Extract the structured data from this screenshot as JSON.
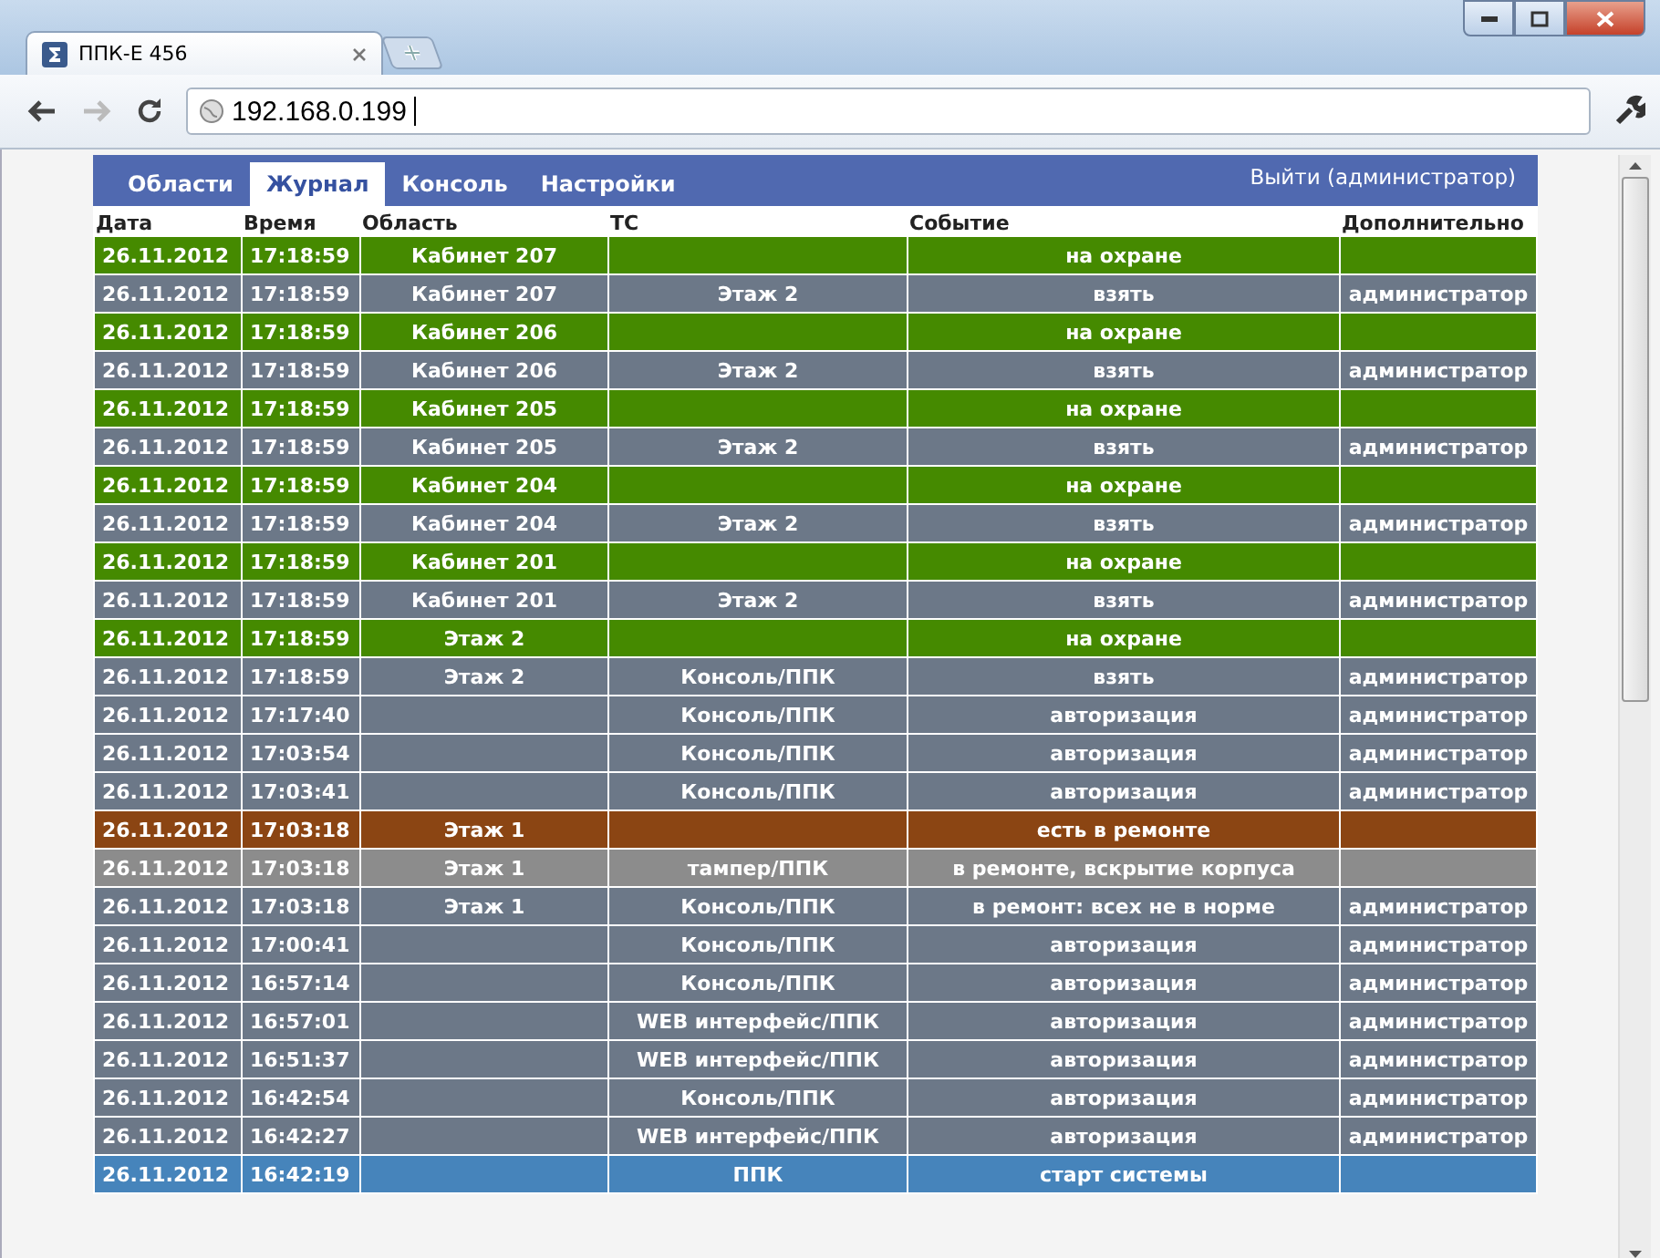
{
  "browser": {
    "tab_title": "ППК-Е 456",
    "address": "192.168.0.199"
  },
  "nav": {
    "tabs": [
      {
        "label": "Области",
        "selected": false
      },
      {
        "label": "Журнал",
        "selected": true
      },
      {
        "label": "Консоль",
        "selected": false
      },
      {
        "label": "Настройки",
        "selected": false
      }
    ],
    "logout": "Выйти (администратор)"
  },
  "table": {
    "columns": [
      "Дата",
      "Время",
      "Область",
      "ТС",
      "Событие",
      "Дополнительно"
    ],
    "rows": [
      {
        "kind": "armed",
        "cells": [
          "26.11.2012",
          "17:18:59",
          "Кабинет 207",
          "",
          "на охране",
          ""
        ]
      },
      {
        "kind": "event",
        "cells": [
          "26.11.2012",
          "17:18:59",
          "Кабинет 207",
          "Этаж 2",
          "взять",
          "администратор"
        ]
      },
      {
        "kind": "armed",
        "cells": [
          "26.11.2012",
          "17:18:59",
          "Кабинет 206",
          "",
          "на охране",
          ""
        ]
      },
      {
        "kind": "event",
        "cells": [
          "26.11.2012",
          "17:18:59",
          "Кабинет 206",
          "Этаж 2",
          "взять",
          "администратор"
        ]
      },
      {
        "kind": "armed",
        "cells": [
          "26.11.2012",
          "17:18:59",
          "Кабинет 205",
          "",
          "на охране",
          ""
        ]
      },
      {
        "kind": "event",
        "cells": [
          "26.11.2012",
          "17:18:59",
          "Кабинет 205",
          "Этаж 2",
          "взять",
          "администратор"
        ]
      },
      {
        "kind": "armed",
        "cells": [
          "26.11.2012",
          "17:18:59",
          "Кабинет 204",
          "",
          "на охране",
          ""
        ]
      },
      {
        "kind": "event",
        "cells": [
          "26.11.2012",
          "17:18:59",
          "Кабинет 204",
          "Этаж 2",
          "взять",
          "администратор"
        ]
      },
      {
        "kind": "armed",
        "cells": [
          "26.11.2012",
          "17:18:59",
          "Кабинет 201",
          "",
          "на охране",
          ""
        ]
      },
      {
        "kind": "event",
        "cells": [
          "26.11.2012",
          "17:18:59",
          "Кабинет 201",
          "Этаж 2",
          "взять",
          "администратор"
        ]
      },
      {
        "kind": "armed",
        "cells": [
          "26.11.2012",
          "17:18:59",
          "Этаж 2",
          "",
          "на охране",
          ""
        ]
      },
      {
        "kind": "event",
        "cells": [
          "26.11.2012",
          "17:18:59",
          "Этаж 2",
          "Консоль/ППК",
          "взять",
          "администратор"
        ]
      },
      {
        "kind": "event",
        "cells": [
          "26.11.2012",
          "17:17:40",
          "",
          "Консоль/ППК",
          "авторизация",
          "администратор"
        ]
      },
      {
        "kind": "event",
        "cells": [
          "26.11.2012",
          "17:03:54",
          "",
          "Консоль/ППК",
          "авторизация",
          "администратор"
        ]
      },
      {
        "kind": "event",
        "cells": [
          "26.11.2012",
          "17:03:41",
          "",
          "Консоль/ППК",
          "авторизация",
          "администратор"
        ]
      },
      {
        "kind": "repair",
        "cells": [
          "26.11.2012",
          "17:03:18",
          "Этаж 1",
          "",
          "есть в ремонте",
          ""
        ]
      },
      {
        "kind": "fault",
        "cells": [
          "26.11.2012",
          "17:03:18",
          "Этаж 1",
          "тампер/ППК",
          "в ремонте, вскрытие корпуса",
          ""
        ]
      },
      {
        "kind": "event",
        "cells": [
          "26.11.2012",
          "17:03:18",
          "Этаж 1",
          "Консоль/ППК",
          "в ремонт: всех не в норме",
          "администратор"
        ]
      },
      {
        "kind": "event",
        "cells": [
          "26.11.2012",
          "17:00:41",
          "",
          "Консоль/ППК",
          "авторизация",
          "администратор"
        ]
      },
      {
        "kind": "event",
        "cells": [
          "26.11.2012",
          "16:57:14",
          "",
          "Консоль/ППК",
          "авторизация",
          "администратор"
        ]
      },
      {
        "kind": "event",
        "cells": [
          "26.11.2012",
          "16:57:01",
          "",
          "WEB интерфейс/ППК",
          "авторизация",
          "администратор"
        ]
      },
      {
        "kind": "event",
        "cells": [
          "26.11.2012",
          "16:51:37",
          "",
          "WEB интерфейс/ППК",
          "авторизация",
          "администратор"
        ]
      },
      {
        "kind": "event",
        "cells": [
          "26.11.2012",
          "16:42:54",
          "",
          "Консоль/ППК",
          "авторизация",
          "администратор"
        ]
      },
      {
        "kind": "event",
        "cells": [
          "26.11.2012",
          "16:42:27",
          "",
          "WEB интерфейс/ППК",
          "авторизация",
          "администратор"
        ]
      },
      {
        "kind": "start",
        "cells": [
          "26.11.2012",
          "16:42:19",
          "",
          "ППК",
          "старт системы",
          ""
        ]
      }
    ]
  }
}
